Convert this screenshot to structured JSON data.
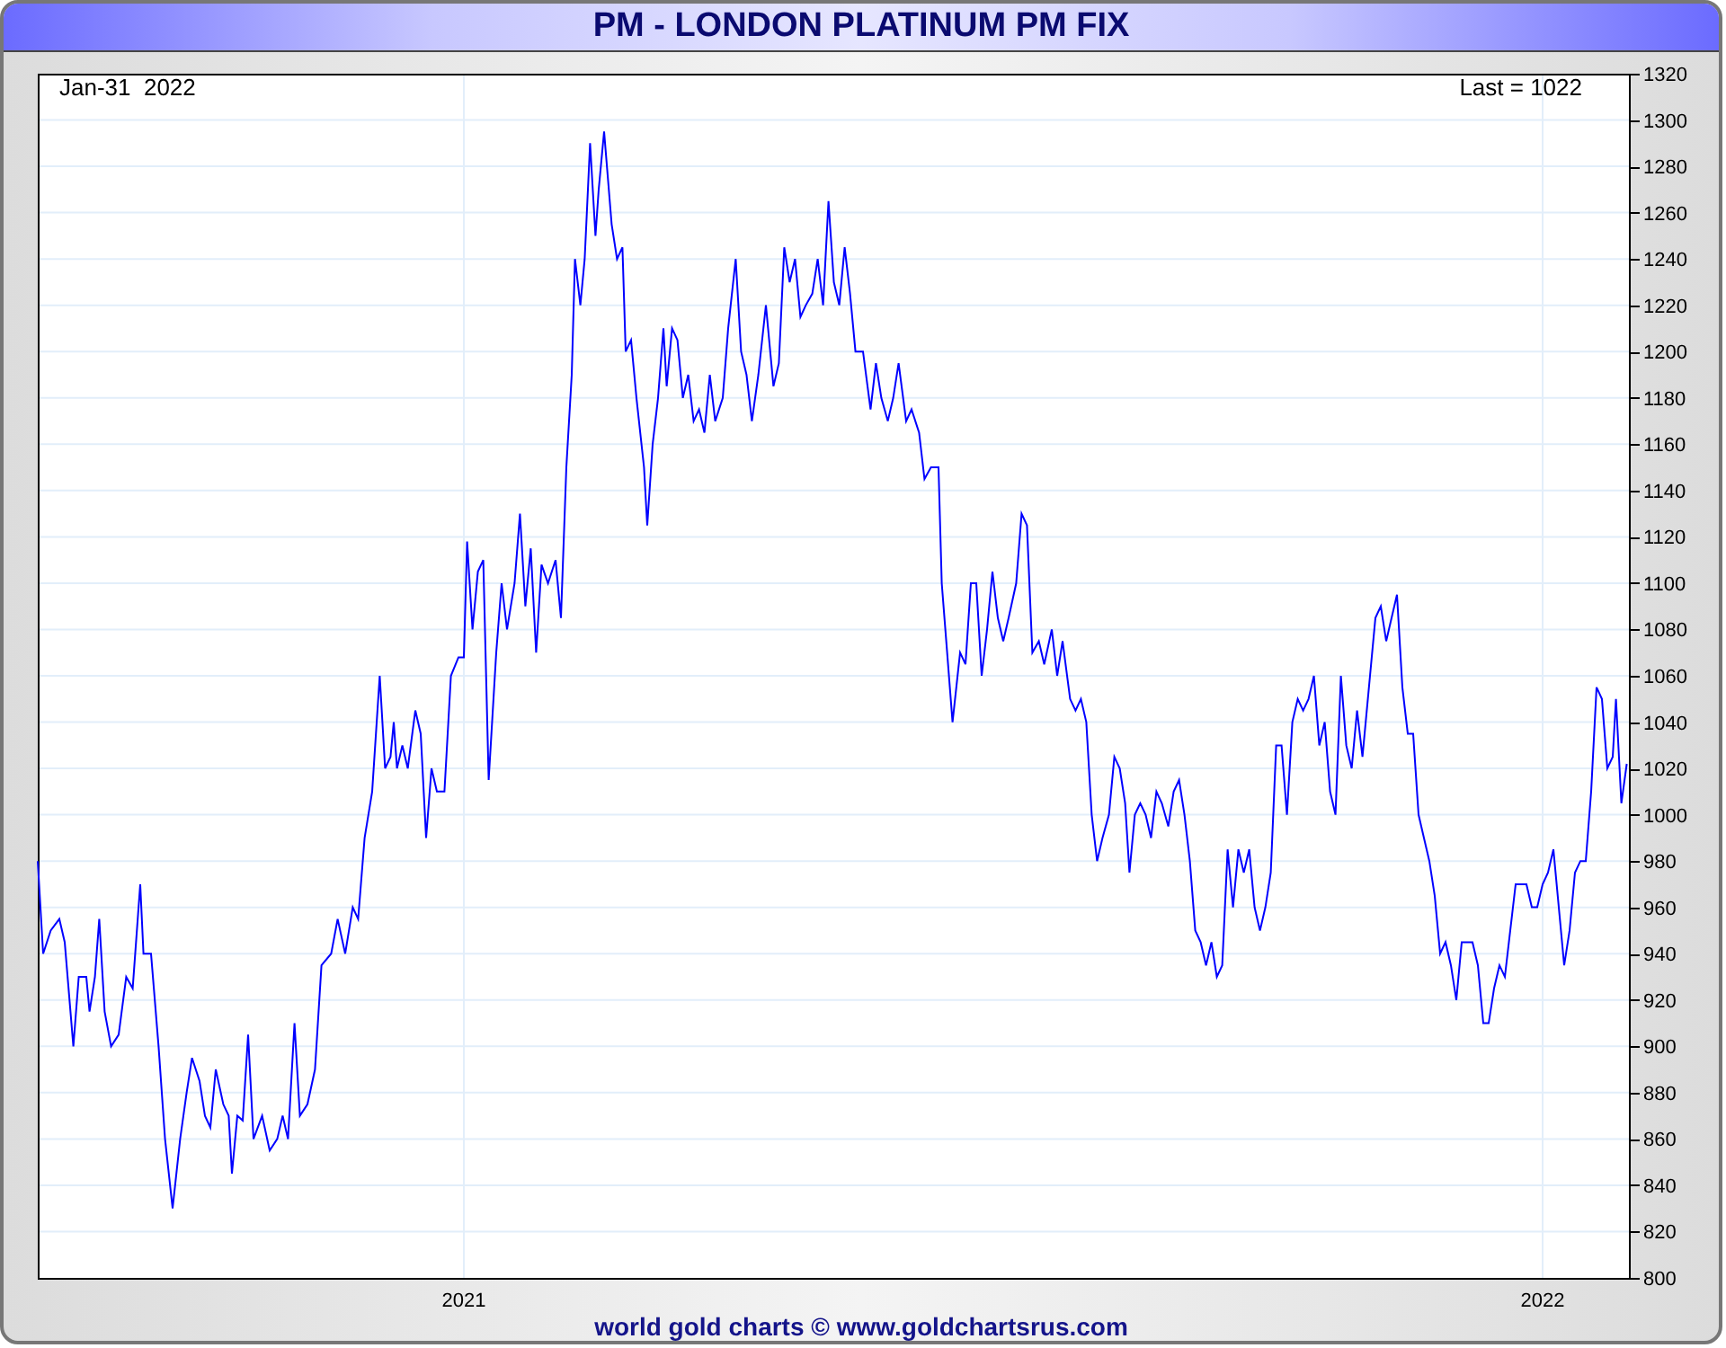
{
  "title": "PM - LONDON PLATINUM PM FIX",
  "chart": {
    "date_label": "Jan-31  2022",
    "last_label": "Last = 1022",
    "chart_data": {
      "type": "line",
      "x": [
        2020.605,
        2020.61,
        2020.617,
        2020.625,
        2020.63,
        2020.638,
        2020.643,
        2020.65,
        2020.653,
        2020.658,
        2020.662,
        2020.667,
        2020.673,
        2020.68,
        2020.687,
        2020.693,
        2020.7,
        2020.703,
        2020.71,
        2020.717,
        2020.723,
        2020.73,
        2020.737,
        2020.743,
        2020.748,
        2020.755,
        2020.76,
        2020.765,
        2020.77,
        2020.777,
        2020.782,
        2020.785,
        2020.79,
        2020.795,
        2020.8,
        2020.805,
        2020.813,
        2020.82,
        2020.827,
        2020.832,
        2020.837,
        2020.843,
        2020.848,
        2020.855,
        2020.862,
        2020.868,
        2020.877,
        2020.883,
        2020.89,
        2020.897,
        2020.902,
        2020.908,
        2020.915,
        2020.922,
        2020.927,
        2020.932,
        2020.935,
        2020.938,
        2020.943,
        2020.948,
        2020.955,
        2020.96,
        2020.965,
        2020.97,
        2020.975,
        2020.982,
        2020.988,
        2020.995,
        2021,
        2021.003,
        2021.008,
        2021.013,
        2021.018,
        2021.023,
        2021.03,
        2021.035,
        2021.04,
        2021.047,
        2021.052,
        2021.057,
        2021.062,
        2021.067,
        2021.072,
        2021.078,
        2021.085,
        2021.09,
        2021.095,
        2021.1,
        2021.103,
        2021.108,
        2021.112,
        2021.117,
        2021.122,
        2021.125,
        2021.13,
        2021.137,
        2021.142,
        2021.147,
        2021.15,
        2021.155,
        2021.16,
        2021.167,
        2021.17,
        2021.175,
        2021.18,
        2021.185,
        2021.188,
        2021.193,
        2021.198,
        2021.203,
        2021.208,
        2021.213,
        2021.218,
        2021.223,
        2021.228,
        2021.233,
        2021.24,
        2021.245,
        2021.252,
        2021.257,
        2021.262,
        2021.267,
        2021.273,
        2021.28,
        2021.287,
        2021.292,
        2021.297,
        2021.302,
        2021.307,
        2021.312,
        2021.317,
        2021.323,
        2021.328,
        2021.333,
        2021.338,
        2021.343,
        2021.348,
        2021.353,
        2021.358,
        2021.363,
        2021.37,
        2021.377,
        2021.382,
        2021.387,
        2021.393,
        2021.398,
        2021.403,
        2021.41,
        2021.415,
        2021.422,
        2021.427,
        2021.433,
        2021.44,
        2021.443,
        2021.448,
        2021.453,
        2021.46,
        2021.465,
        2021.47,
        2021.475,
        2021.48,
        2021.485,
        2021.49,
        2021.495,
        2021.5,
        2021.505,
        2021.512,
        2021.517,
        2021.522,
        2021.527,
        2021.533,
        2021.538,
        2021.545,
        2021.55,
        2021.555,
        2021.562,
        2021.567,
        2021.572,
        2021.577,
        2021.582,
        2021.587,
        2021.592,
        2021.598,
        2021.603,
        2021.608,
        2021.613,
        2021.617,
        2021.622,
        2021.627,
        2021.632,
        2021.637,
        2021.642,
        2021.647,
        2021.653,
        2021.658,
        2021.663,
        2021.668,
        2021.673,
        2021.678,
        2021.683,
        2021.688,
        2021.693,
        2021.698,
        2021.703,
        2021.708,
        2021.713,
        2021.718,
        2021.723,
        2021.728,
        2021.733,
        2021.738,
        2021.743,
        2021.748,
        2021.753,
        2021.758,
        2021.763,
        2021.768,
        2021.773,
        2021.778,
        2021.783,
        2021.788,
        2021.793,
        2021.798,
        2021.803,
        2021.808,
        2021.813,
        2021.818,
        2021.823,
        2021.828,
        2021.833,
        2021.84,
        2021.845,
        2021.85,
        2021.855,
        2021.86,
        2021.865,
        2021.87,
        2021.875,
        2021.88,
        2021.885,
        2021.89,
        2021.895,
        2021.9,
        2021.905,
        2021.91,
        2021.915,
        2021.92,
        2021.925,
        2021.93,
        2021.935,
        2021.94,
        2021.945,
        2021.95,
        2021.955,
        2021.96,
        2021.965,
        2021.97,
        2021.975,
        2021.98,
        2021.985,
        2021.99,
        2021.995,
        2022,
        2022.005,
        2022.01,
        2022.015,
        2022.02,
        2022.025,
        2022.03,
        2022.035,
        2022.04,
        2022.045,
        2022.05,
        2022.055,
        2022.06,
        2022.065,
        2022.068,
        2022.073,
        2022.078
      ],
      "series": [
        {
          "color": "#0000ff",
          "values": [
            980,
            940,
            950,
            955,
            945,
            900,
            930,
            930,
            915,
            930,
            955,
            915,
            900,
            905,
            930,
            925,
            970,
            940,
            940,
            900,
            860,
            830,
            860,
            880,
            895,
            885,
            870,
            865,
            890,
            875,
            870,
            845,
            870,
            868,
            905,
            860,
            870,
            855,
            860,
            870,
            860,
            910,
            870,
            875,
            890,
            935,
            940,
            955,
            940,
            960,
            955,
            990,
            1010,
            1060,
            1020,
            1025,
            1040,
            1020,
            1030,
            1020,
            1045,
            1035,
            990,
            1020,
            1010,
            1010,
            1060,
            1068,
            1068,
            1118,
            1080,
            1105,
            1110,
            1015,
            1070,
            1100,
            1080,
            1100,
            1130,
            1090,
            1115,
            1070,
            1108,
            1100,
            1110,
            1085,
            1150,
            1190,
            1240,
            1220,
            1240,
            1290,
            1250,
            1270,
            1295,
            1255,
            1240,
            1245,
            1200,
            1205,
            1180,
            1150,
            1125,
            1160,
            1180,
            1210,
            1185,
            1210,
            1205,
            1180,
            1190,
            1170,
            1175,
            1165,
            1190,
            1170,
            1180,
            1210,
            1240,
            1200,
            1190,
            1170,
            1190,
            1220,
            1185,
            1195,
            1245,
            1230,
            1240,
            1215,
            1220,
            1225,
            1240,
            1220,
            1265,
            1230,
            1220,
            1245,
            1225,
            1200,
            1200,
            1175,
            1195,
            1180,
            1170,
            1180,
            1195,
            1170,
            1175,
            1165,
            1145,
            1150,
            1150,
            1100,
            1070,
            1040,
            1070,
            1065,
            1100,
            1100,
            1060,
            1080,
            1105,
            1085,
            1075,
            1085,
            1100,
            1130,
            1125,
            1070,
            1075,
            1065,
            1080,
            1060,
            1075,
            1050,
            1045,
            1050,
            1040,
            1000,
            980,
            990,
            1000,
            1025,
            1020,
            1005,
            975,
            1000,
            1005,
            1000,
            990,
            1010,
            1005,
            995,
            1010,
            1015,
            1000,
            980,
            950,
            945,
            935,
            945,
            930,
            935,
            985,
            960,
            985,
            975,
            985,
            960,
            950,
            960,
            975,
            1030,
            1030,
            1000,
            1040,
            1050,
            1045,
            1050,
            1060,
            1030,
            1040,
            1010,
            1000,
            1060,
            1030,
            1020,
            1045,
            1025,
            1060,
            1085,
            1090,
            1075,
            1085,
            1095,
            1055,
            1035,
            1035,
            1000,
            990,
            980,
            965,
            940,
            945,
            935,
            920,
            945,
            945,
            945,
            935,
            910,
            910,
            925,
            935,
            930,
            950,
            970,
            970,
            970,
            960,
            960,
            970,
            975,
            985,
            960,
            935,
            950,
            975,
            980,
            980,
            1010,
            1055,
            1050,
            1020,
            1025,
            1050,
            1005,
            1022
          ]
        }
      ],
      "xlim": [
        2020.605,
        2022.08
      ],
      "ylim": [
        800,
        1320
      ],
      "xticks": [
        2021,
        2022
      ],
      "grid": true,
      "yticks": [
        800,
        820,
        840,
        860,
        880,
        900,
        920,
        940,
        960,
        980,
        1000,
        1020,
        1040,
        1060,
        1080,
        1100,
        1120,
        1140,
        1160,
        1180,
        1200,
        1220,
        1240,
        1260,
        1280,
        1300,
        1320
      ]
    }
  },
  "footer": "world gold charts © www.goldchartsrus.com"
}
